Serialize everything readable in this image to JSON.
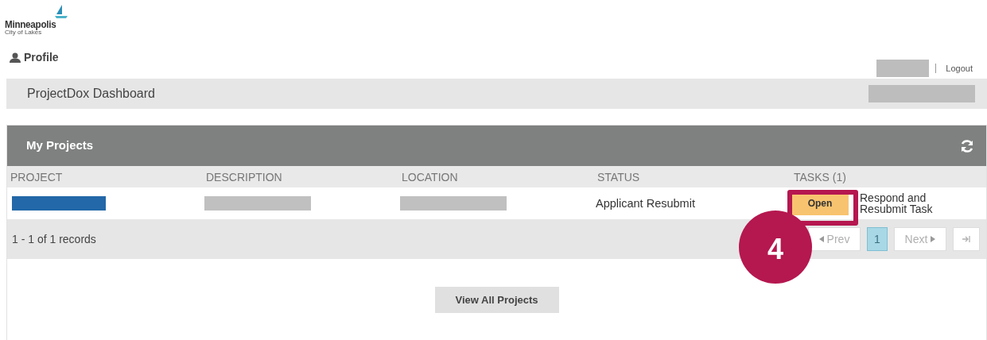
{
  "logo": {
    "name": "Minneapolis",
    "tagline": "City of Lakes"
  },
  "profile": {
    "label": "Profile"
  },
  "user_menu": {
    "logout": "Logout"
  },
  "dashboard": {
    "title": "ProjectDox Dashboard"
  },
  "panel": {
    "title": "My Projects",
    "columns": [
      "PROJECT",
      "DESCRIPTION",
      "LOCATION",
      "STATUS",
      "TASKS (1)"
    ],
    "rows": [
      {
        "status": "Applicant Resubmit",
        "task_button": "Open",
        "task_name": "Respond and Resubmit Task"
      }
    ],
    "records": "1 - 1 of 1 records",
    "pager": [
      {
        "kind": "prev",
        "label": "Prev",
        "disabled": true,
        "selected": false
      },
      {
        "kind": "page",
        "label": "1",
        "disabled": false,
        "selected": true
      },
      {
        "kind": "next",
        "label": "Next",
        "disabled": true,
        "selected": false
      },
      {
        "kind": "last",
        "disabled": true,
        "selected": false
      }
    ],
    "view_all": "View All Projects"
  },
  "callout": {
    "number": "4"
  }
}
